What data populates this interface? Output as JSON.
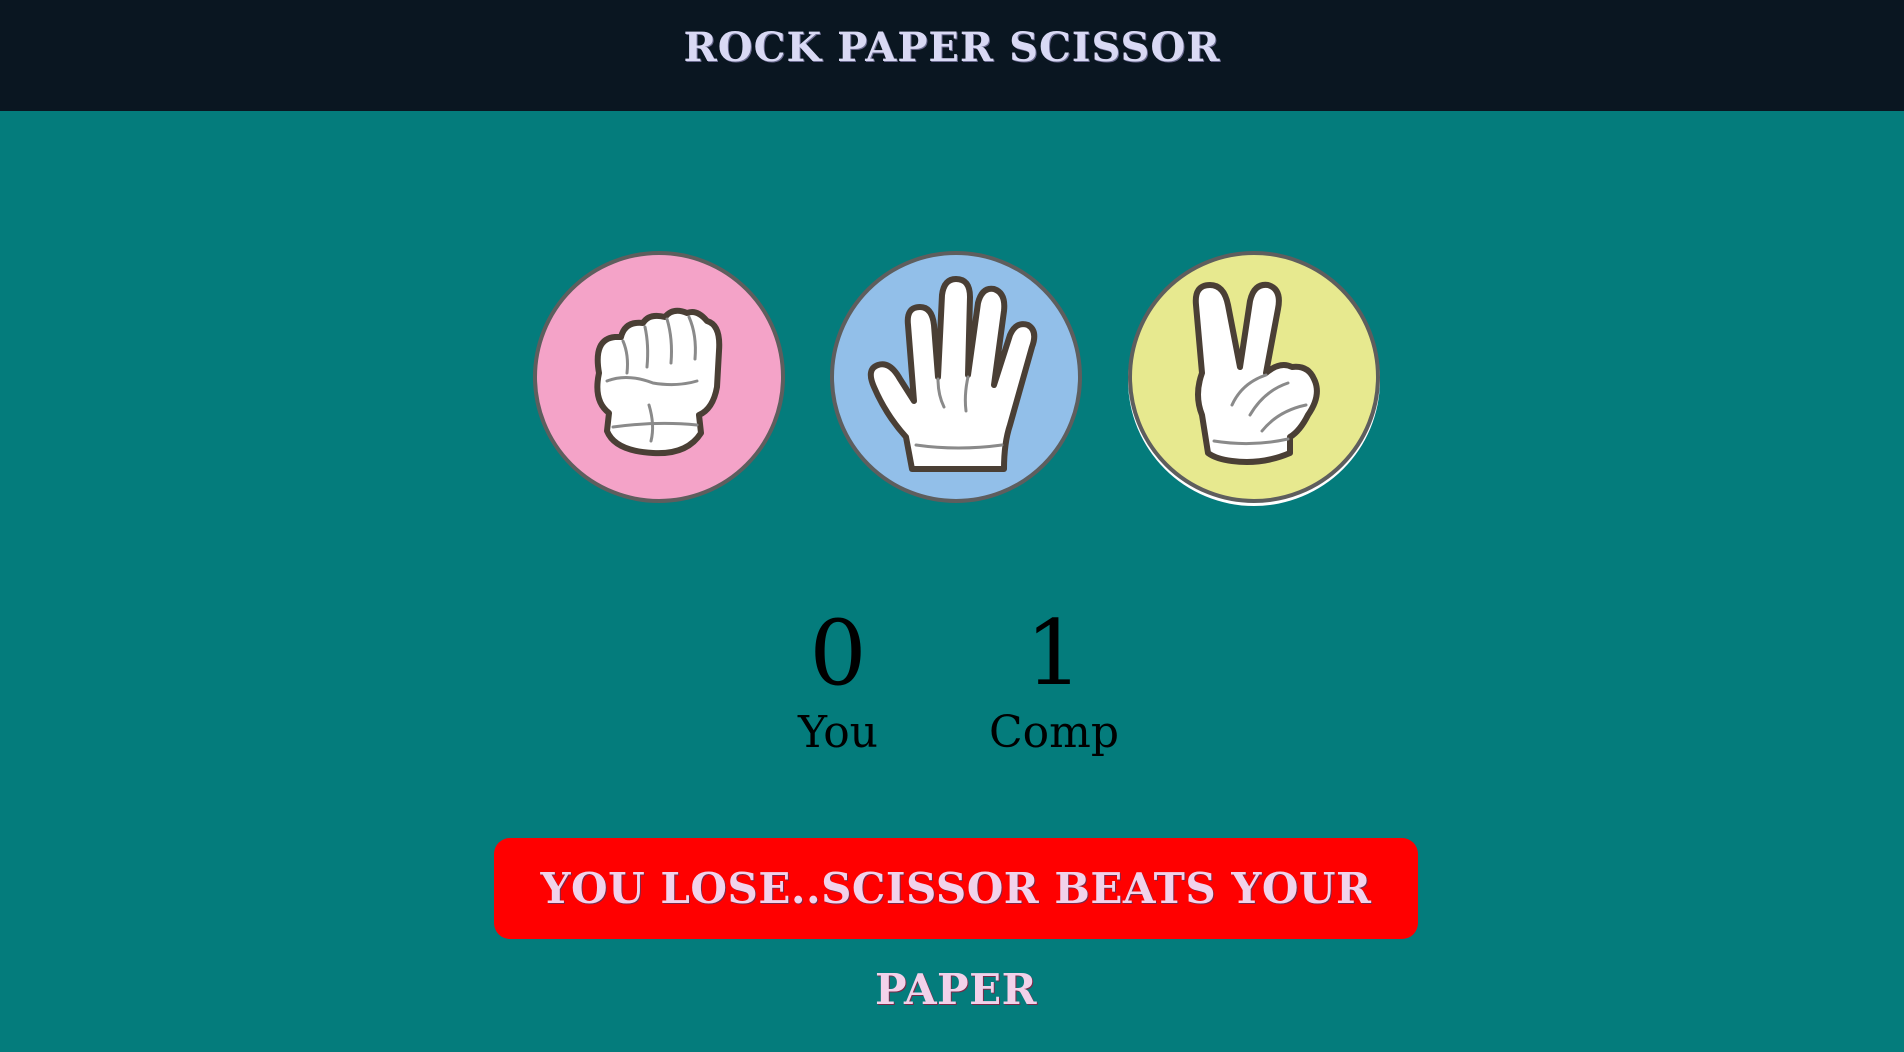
{
  "header": {
    "title": "ROCK PAPER SCISSOR"
  },
  "choices": [
    {
      "id": "rock",
      "icon": "fist-icon",
      "color": "#f4a3c8"
    },
    {
      "id": "paper",
      "icon": "open-hand-icon",
      "color": "#92bfe9"
    },
    {
      "id": "scissor",
      "icon": "peace-sign-icon",
      "color": "#e7e98f"
    }
  ],
  "score": {
    "user_value": "0",
    "user_label": "You",
    "comp_value": "1",
    "comp_label": "Comp"
  },
  "message": {
    "text": "YOU LOSE..SCISSOR BEATS YOUR PAPER",
    "background": "#ff0000"
  },
  "colors": {
    "header_bg": "#0a1621",
    "page_bg": "#047c7c"
  }
}
